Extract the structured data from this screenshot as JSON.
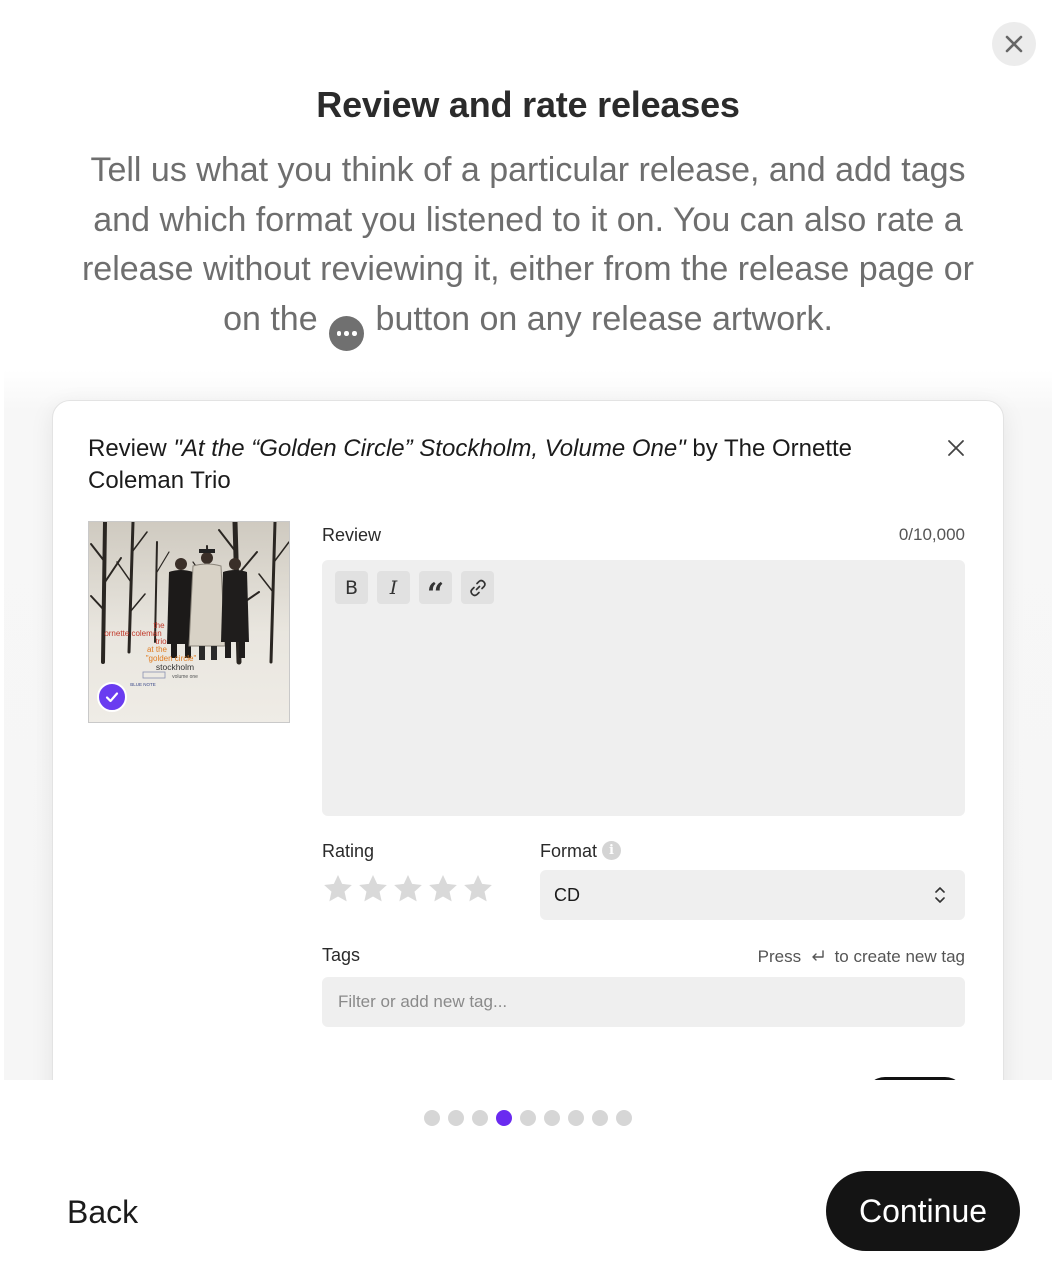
{
  "modal": {
    "title": "Review and rate releases",
    "description_before_icon": "Tell us what you think of a particular release, and add tags and which format you listened to it on. You can also rate a release without reviewing it, either from the release page or on the",
    "description_after_icon": "button on any release artwork.",
    "close_icon": "close-icon"
  },
  "review_card": {
    "title_prefix": "Review ",
    "release_name": "\"At the “Golden Circle” Stockholm, Volume One\"",
    "title_suffix": " by The Ornette Coleman Trio",
    "cover_text": {
      "line1": "the",
      "line2": "ornette coleman",
      "line3": "trio",
      "line4": "at the",
      "line5": "\"golden circle\"",
      "line6": "stockholm",
      "line7": "volume one",
      "label": "BLUE NOTE"
    },
    "review_label": "Review",
    "char_count": "0/10,000",
    "toolbar": {
      "bold": "B",
      "italic": "I",
      "quote": "“",
      "link_icon": "link-icon"
    },
    "rating_label": "Rating",
    "rating_value": 0,
    "rating_max": 5,
    "format_label": "Format",
    "format_info": "i",
    "format_value": "CD",
    "tags_label": "Tags",
    "tags_hint_before": "Press",
    "tags_hint_after": "to create new tag",
    "tags_placeholder": "Filter or add new tag..."
  },
  "pagination": {
    "total": 9,
    "active_index": 3
  },
  "footer": {
    "back_label": "Back",
    "continue_label": "Continue"
  },
  "colors": {
    "accent": "#6a2af0",
    "check_badge": "#6a3cf0",
    "primary_button": "#141414"
  }
}
